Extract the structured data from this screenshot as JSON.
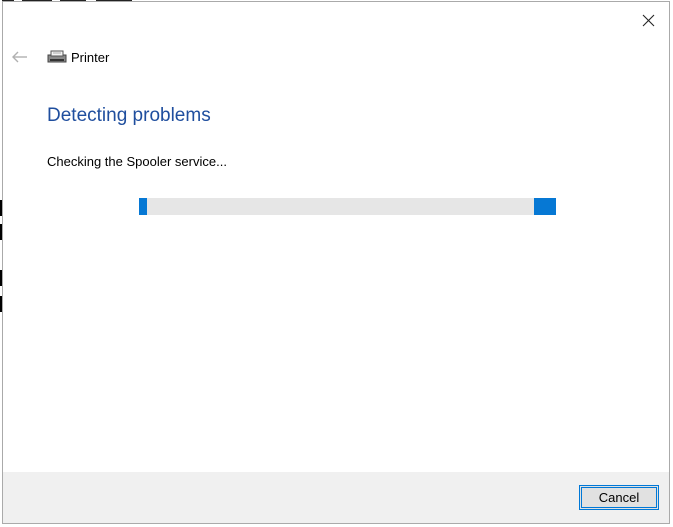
{
  "window": {
    "title": "Printer",
    "icons": {
      "back": "back-arrow-icon",
      "close": "close-icon",
      "app": "printer-icon"
    }
  },
  "main": {
    "heading": "Detecting problems",
    "status": "Checking the Spooler service...",
    "progress": {
      "mode": "indeterminate",
      "color": "#0678d4",
      "track_color": "#e6e6e6"
    }
  },
  "footer": {
    "cancel_label": "Cancel"
  },
  "colors": {
    "heading": "#1f4e9e",
    "accent": "#0078d7",
    "footer_bg": "#f0f0f0"
  }
}
